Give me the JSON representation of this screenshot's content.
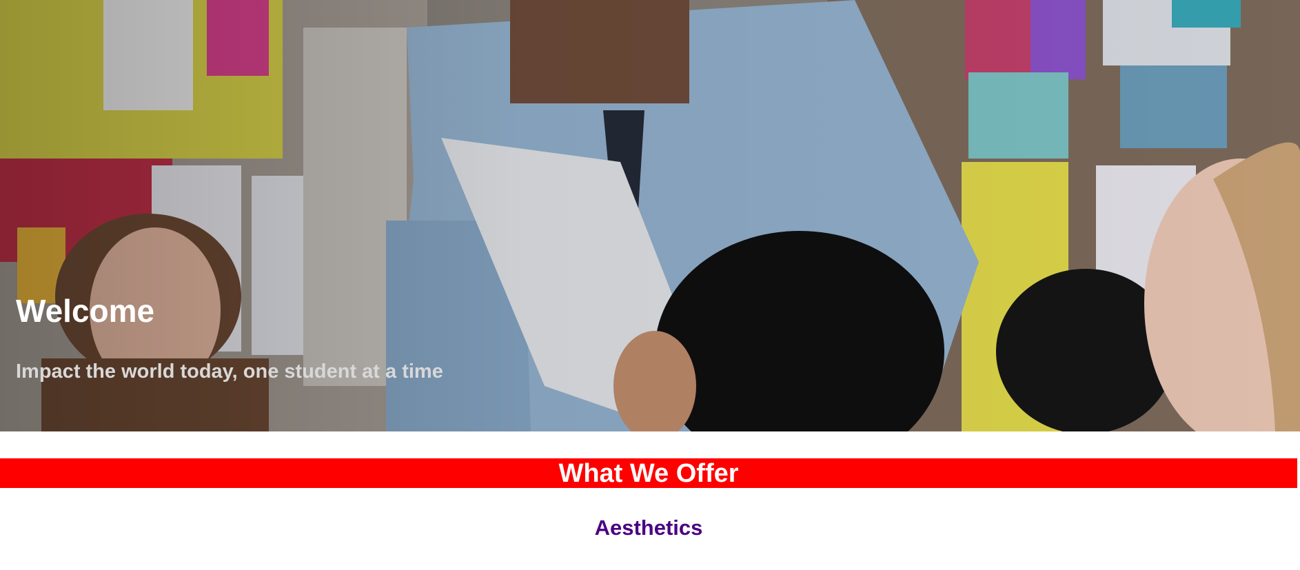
{
  "hero": {
    "title": "Welcome",
    "subtitle": "Impact the world today, one student at a time",
    "image_alt": "teacher-handing-paper-to-students-in-classroom"
  },
  "offer": {
    "heading": "What We Offer",
    "items": [
      {
        "title": "Aesthetics"
      }
    ]
  },
  "colors": {
    "banner_background": "#ff0000",
    "banner_text": "#ffffff",
    "item_title": "#4b0082",
    "hero_title": "#ffffff",
    "hero_subtitle": "#d8d8d8"
  }
}
